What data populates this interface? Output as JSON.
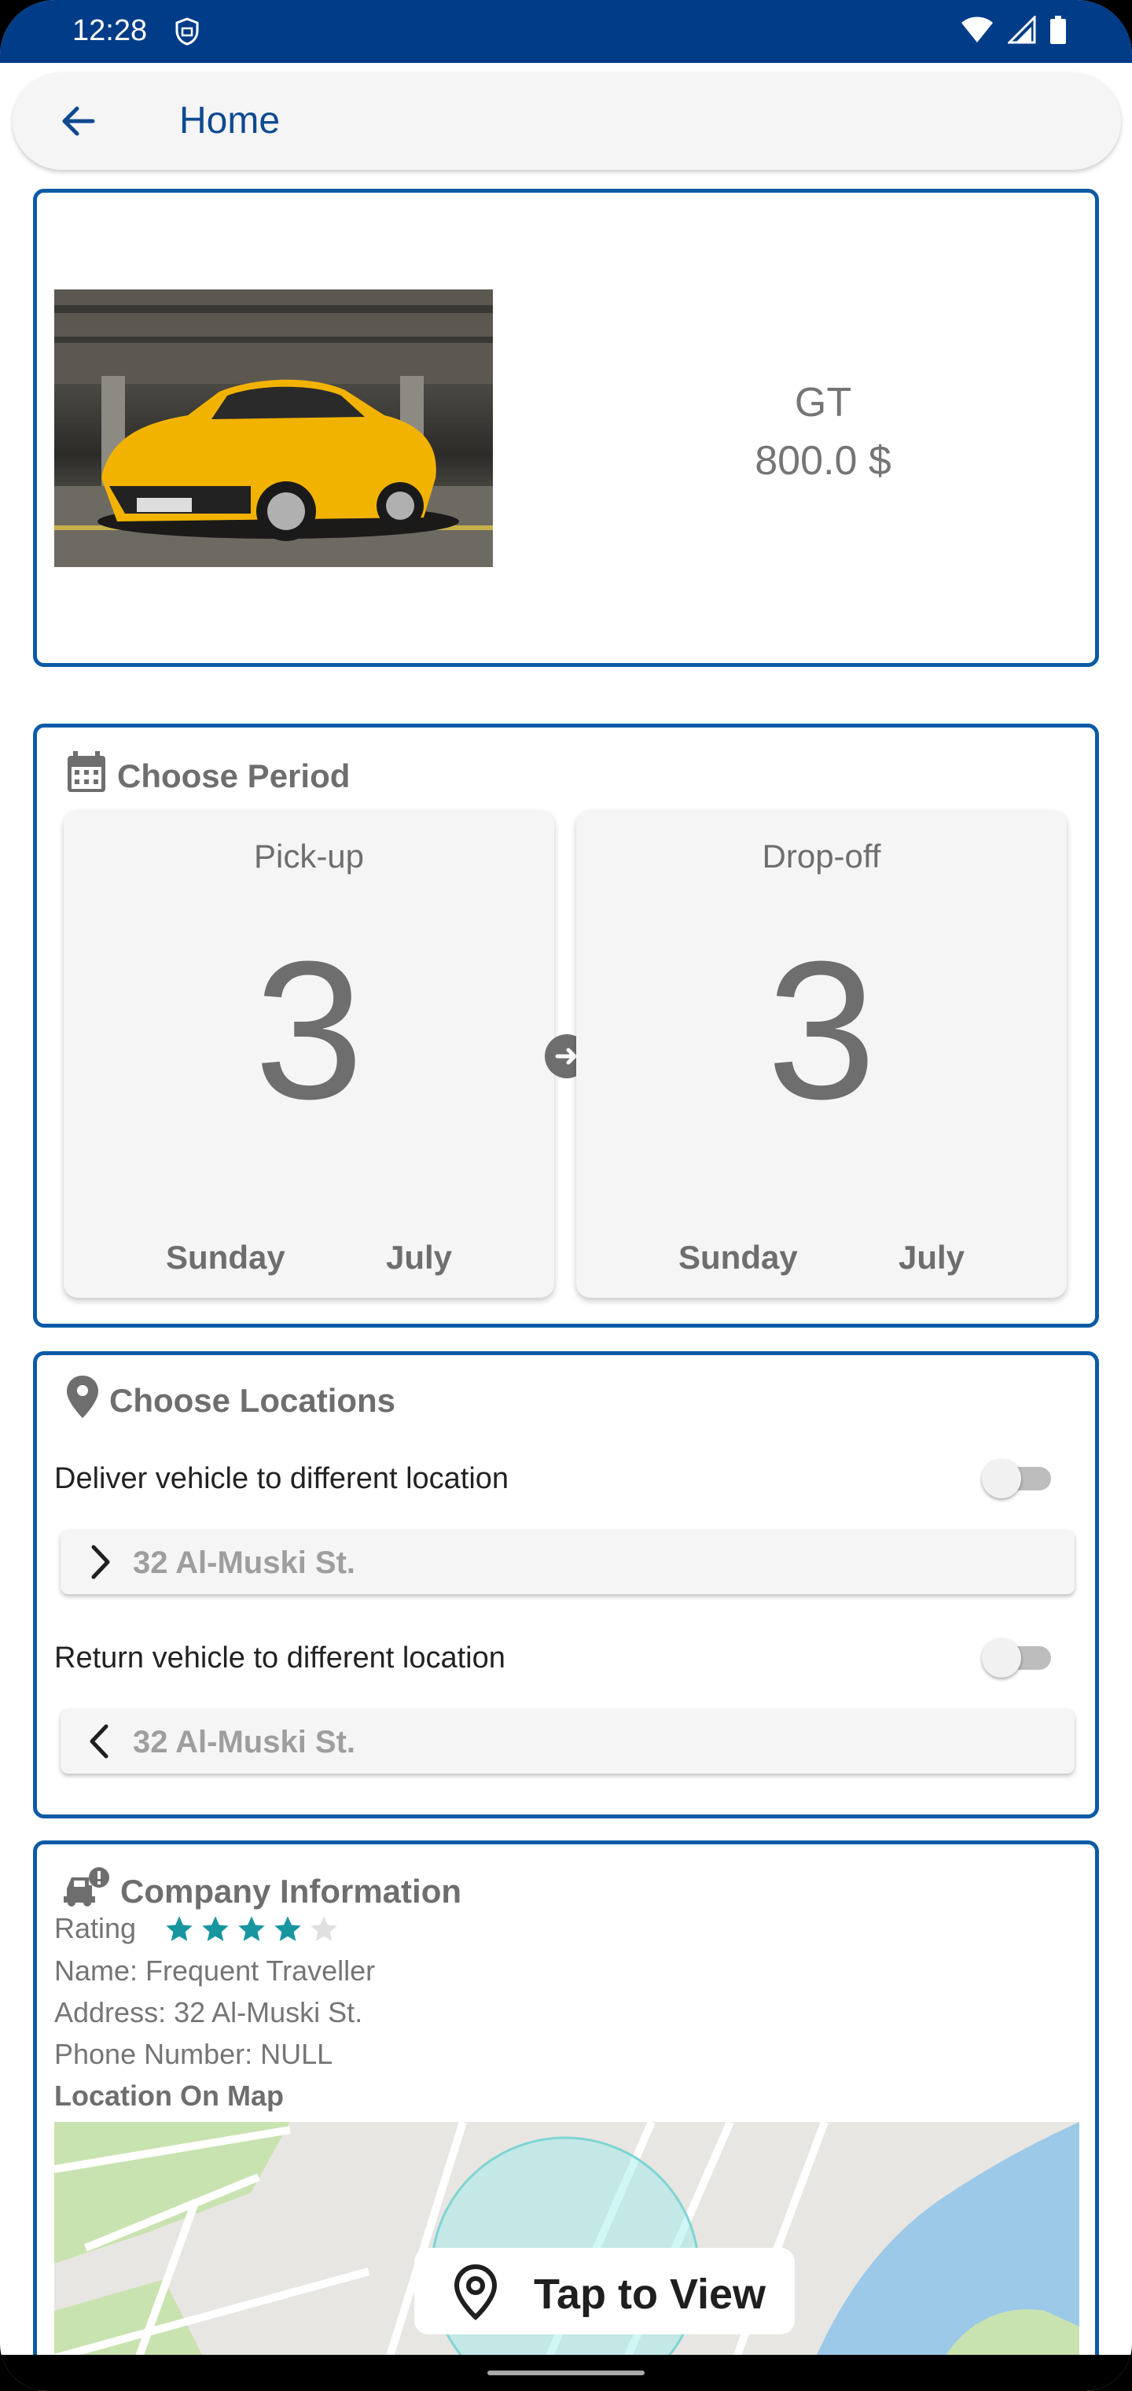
{
  "status_bar": {
    "time": "12:28"
  },
  "app_bar": {
    "title": "Home"
  },
  "car": {
    "name": "GT",
    "price": "800.0 $"
  },
  "period": {
    "heading": "Choose Period",
    "pickup": {
      "label": "Pick-up",
      "day_num": "3",
      "weekday": "Sunday",
      "month": "July"
    },
    "dropoff": {
      "label": "Drop-off",
      "day_num": "3",
      "weekday": "Sunday",
      "month": "July"
    }
  },
  "locations": {
    "heading": "Choose Locations",
    "deliver_label": "Deliver vehicle to different location",
    "deliver_address": "32 Al-Muski St.",
    "return_label": "Return vehicle to different location",
    "return_address": "32 Al-Muski St."
  },
  "company": {
    "heading": "Company Information",
    "rating_label": "Rating",
    "rating_value": 4,
    "rating_max": 5,
    "name": "Name: Frequent Traveller",
    "address": "Address: 32 Al-Muski St.",
    "phone": "Phone Number: NULL",
    "map_label": "Location On Map",
    "tap_to_view": "Tap to View"
  },
  "colors": {
    "status_bar": "#003c88",
    "card_border": "#0d5aa6",
    "star": "#1796a0",
    "star_empty": "#e0e0e0"
  }
}
